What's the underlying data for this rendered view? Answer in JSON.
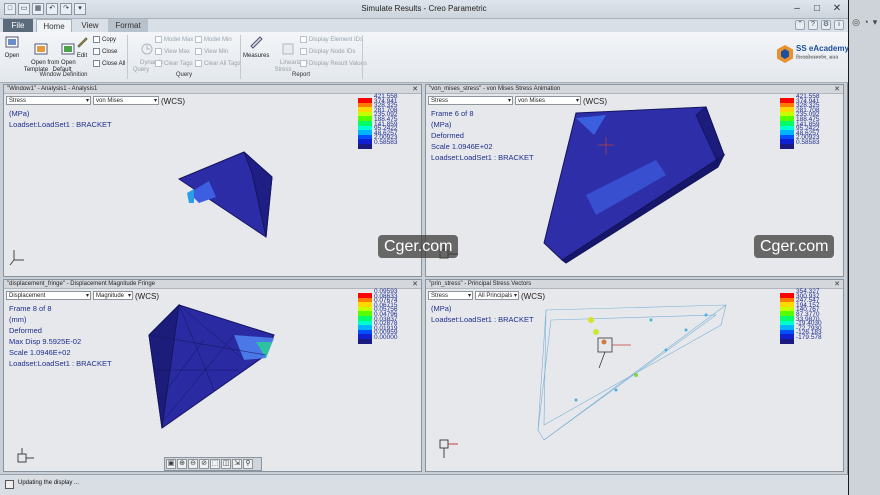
{
  "qat": [
    "□",
    "▭",
    "▦",
    "↶",
    "↷",
    "▾"
  ],
  "title": "Simulate Results - Creo Parametric",
  "window_buttons": [
    "–",
    "□",
    "✕"
  ],
  "tabs": [
    {
      "label": "File"
    },
    {
      "label": "Home"
    },
    {
      "label": "View"
    },
    {
      "label": "Format"
    }
  ],
  "ribbon": {
    "window_definition": {
      "label": "Window Definition",
      "open": "Open",
      "open_from_template": "Open from\nTemplate",
      "open_default": "Open\nDefault",
      "edit": "Edit",
      "copy": "Copy",
      "close": "Close",
      "close_all": "Close All"
    },
    "query": {
      "label": "Query",
      "dynamic_query": "Dynamic\nQuery",
      "model_max": "Model Max",
      "view_max": "View Max",
      "clear_tags": "Clear Tags",
      "model_min": "Model Min",
      "view_min": "View Min",
      "clear_all_tags": "Clear All Tags"
    },
    "report": {
      "label": "Report",
      "measures": "Measures",
      "linearized_stress": "Linearized\nStress",
      "display_element_ids": "Display Element IDs",
      "display_node_ids": "Display Node IDs",
      "display_result_values": "Display Result Values"
    }
  },
  "logo": {
    "name": "SS eAcademy",
    "tagline": "विश्वकोशसमर्पण, सतत"
  },
  "viewports": [
    {
      "title": "\"Window1\" - Analysis1 - Analysis1",
      "select1": "Stress",
      "select2": "von Mises",
      "wcs": "(WCS)",
      "info": [
        "(MPa)",
        "Loadset:LoadSet1 :  BRACKET"
      ],
      "legend": [
        "421.558",
        "374.941",
        "328.325",
        "281.708",
        "235.092",
        "188.475",
        "141.859",
        "95.2422",
        "48.6257",
        "2.00923",
        "0.58583"
      ]
    },
    {
      "title": "\"von_mises_stress\" - von Mises Stress Animation",
      "select1": "Stress",
      "select2": "von Mises",
      "wcs": "(WCS)",
      "info": [
        "Frame 6 of 8",
        "(MPa)",
        "Deformed",
        "Scale  1.0946E+02",
        "Loadset:LoadSet1 :  BRACKET"
      ],
      "legend": [
        "421.558",
        "374.941",
        "328.325",
        "281.708",
        "235.092",
        "188.475",
        "141.859",
        "95.2422",
        "48.6257",
        "2.00923",
        "0.58583"
      ]
    },
    {
      "title": "\"displacement_fringe\" - Displacement Magnitude Fringe",
      "select1": "Displacement",
      "select2": "Magnitude",
      "wcs": "(WCS)",
      "info": [
        "Frame 8 of 8",
        "(mm)",
        "Deformed",
        "Max Disp  9.5925E-02",
        "Scale  1.0946E+02",
        "Loadset:LoadSet1 :  BRACKET"
      ],
      "legend": [
        "0.09593",
        "0.08633",
        "0.07674",
        "0.06715",
        "0.05756",
        "0.04796",
        "0.03837",
        "0.02878",
        "0.01919",
        "0.00959",
        "0.00000"
      ]
    },
    {
      "title": "\"prin_stress\" - Principal Stress Vectors",
      "select1": "Stress",
      "select2": "All Principals",
      "wcs": "(WCS)",
      "info": [
        "(MPa)",
        "Loadset:LoadSet1 :  BRACKET"
      ],
      "legend": [
        "354.327",
        "300.937",
        "247.547",
        "194.157",
        "140.767",
        "87.3770",
        "33.9870",
        "-19.4030",
        "-72.7930",
        "-126.183",
        "-179.578"
      ]
    }
  ],
  "legend_colors": [
    "#ff0000",
    "#ff7a00",
    "#ffd800",
    "#c8ff00",
    "#55ff00",
    "#00ff66",
    "#00ffd0",
    "#00b4ff",
    "#0050ff",
    "#1020d0",
    "#1a1a80"
  ],
  "watermarks": [
    "Cger.com",
    "Cger.com"
  ],
  "view_tools": [
    "▣",
    "⊕",
    "⊖",
    "⊘",
    "⬚",
    "◫",
    "⇲",
    "⚲"
  ],
  "status": "Updating the display ...",
  "right_pane": [
    "◎",
    "◔",
    "▾"
  ]
}
